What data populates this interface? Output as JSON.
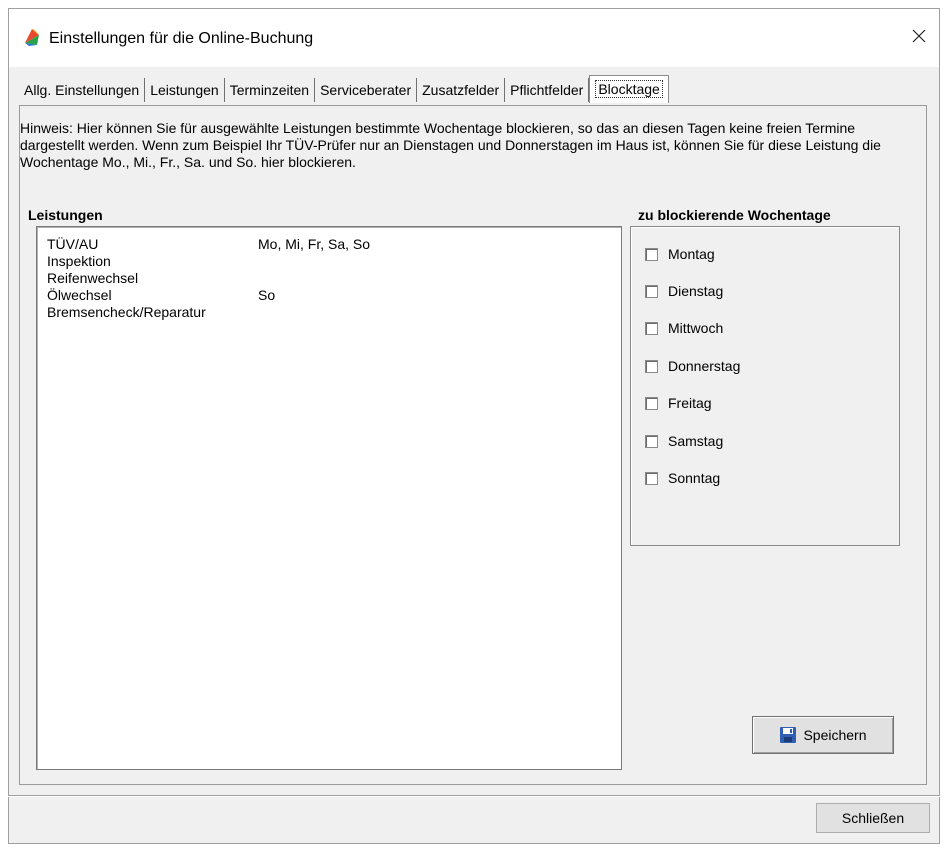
{
  "window": {
    "title": "Einstellungen für die Online-Buchung",
    "close_symbol": "✕"
  },
  "tabs": [
    {
      "label": "Allg. Einstellungen",
      "active": false
    },
    {
      "label": "Leistungen",
      "active": false
    },
    {
      "label": "Terminzeiten",
      "active": false
    },
    {
      "label": "Serviceberater",
      "active": false
    },
    {
      "label": "Zusatzfelder",
      "active": false
    },
    {
      "label": "Pflichtfelder",
      "active": false
    },
    {
      "label": "Blocktage",
      "active": true
    }
  ],
  "hint": "Hinweis: Hier können Sie für ausgewählte Leistungen bestimmte Wochentage blockieren, so das an diesen Tagen keine freien Termine dargestellt werden. Wenn zum Beispiel Ihr TÜV-Prüfer nur an Dienstagen und Donnerstagen im Haus ist, können Sie für diese Leistung die Wochentage Mo., Mi., Fr., Sa. und So. hier blockieren.",
  "services": {
    "heading": "Leistungen",
    "items": [
      {
        "name": "TÜV/AU",
        "days": "Mo, Mi, Fr, Sa, So"
      },
      {
        "name": "Inspektion",
        "days": ""
      },
      {
        "name": "Reifenwechsel",
        "days": ""
      },
      {
        "name": "Ölwechsel",
        "days": "So"
      },
      {
        "name": "Bremsencheck/Reparatur",
        "days": ""
      }
    ]
  },
  "weekdays": {
    "heading": "zu blockierende Wochentage",
    "items": [
      {
        "label": "Montag",
        "checked": false
      },
      {
        "label": "Dienstag",
        "checked": false
      },
      {
        "label": "Mittwoch",
        "checked": false
      },
      {
        "label": "Donnerstag",
        "checked": false
      },
      {
        "label": "Freitag",
        "checked": false
      },
      {
        "label": "Samstag",
        "checked": false
      },
      {
        "label": "Sonntag",
        "checked": false
      }
    ]
  },
  "buttons": {
    "save": "Speichern",
    "close": "Schließen"
  },
  "icons": {
    "app": "app-logo-icon",
    "save": "floppy-disk-icon"
  }
}
